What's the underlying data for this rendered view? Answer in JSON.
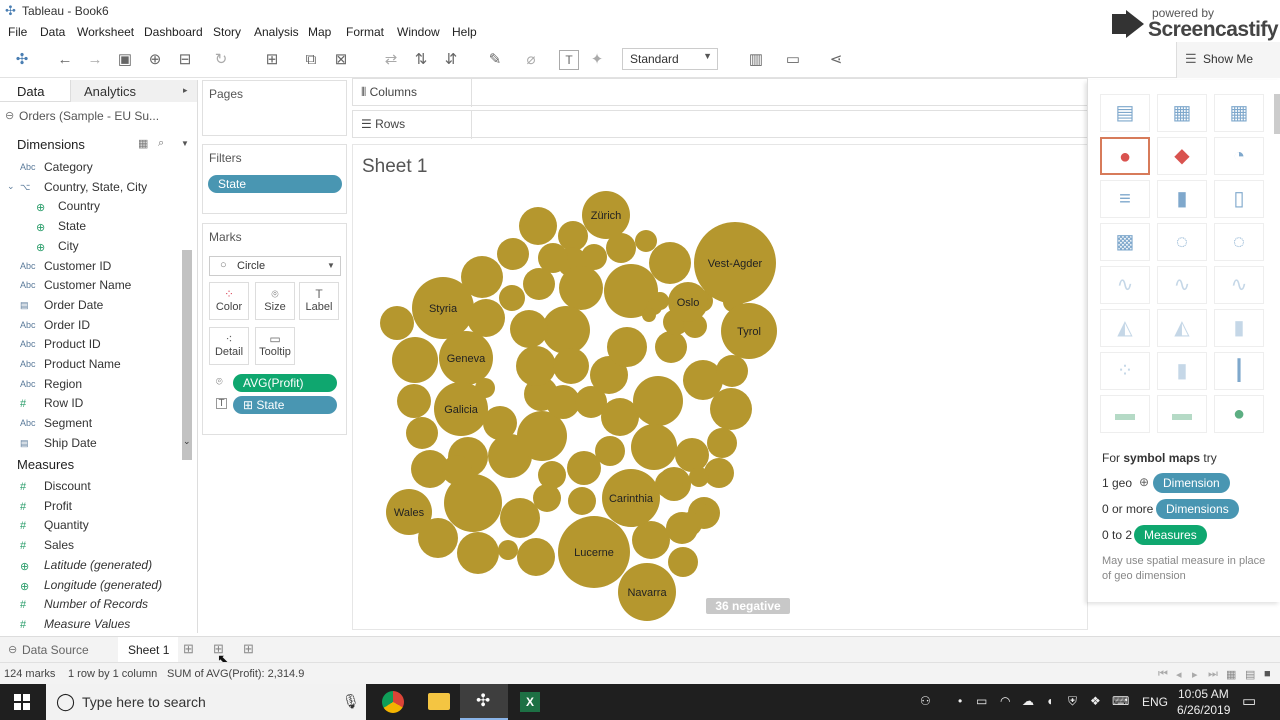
{
  "window": {
    "title": "Tableau - Book6"
  },
  "menu": [
    "File",
    "Data",
    "Worksheet",
    "Dashboard",
    "Story",
    "Analysis",
    "Map",
    "Format",
    "Window",
    "Help"
  ],
  "toolbar": {
    "fit": "Standard",
    "show_me": "Show Me"
  },
  "watermark": {
    "line1": "powered by",
    "line2": "Screencastify"
  },
  "data_pane": {
    "tab_data": "Data",
    "tab_analytics": "Analytics",
    "datasource": "Orders (Sample - EU Su...",
    "dimensions_header": "Dimensions",
    "dimensions": [
      {
        "type": "Abc",
        "label": "Category"
      },
      {
        "type": "hier",
        "label": "Country, State, City"
      },
      {
        "type": "geo",
        "label": "Country"
      },
      {
        "type": "geo",
        "label": "State"
      },
      {
        "type": "geo",
        "label": "City"
      },
      {
        "type": "Abc",
        "label": "Customer ID"
      },
      {
        "type": "Abc",
        "label": "Customer Name"
      },
      {
        "type": "date",
        "label": "Order Date"
      },
      {
        "type": "Abc",
        "label": "Order ID"
      },
      {
        "type": "Abc",
        "label": "Product ID"
      },
      {
        "type": "Abc",
        "label": "Product Name"
      },
      {
        "type": "Abc",
        "label": "Region"
      },
      {
        "type": "#",
        "label": "Row ID"
      },
      {
        "type": "Abc",
        "label": "Segment"
      },
      {
        "type": "date",
        "label": "Ship Date"
      }
    ],
    "measures_header": "Measures",
    "measures": [
      {
        "type": "#",
        "label": "Discount"
      },
      {
        "type": "#",
        "label": "Profit"
      },
      {
        "type": "#",
        "label": "Quantity"
      },
      {
        "type": "#",
        "label": "Sales"
      },
      {
        "type": "geo",
        "label": "Latitude (generated)"
      },
      {
        "type": "geo",
        "label": "Longitude (generated)"
      },
      {
        "type": "#",
        "label": "Number of Records"
      },
      {
        "type": "#",
        "label": "Measure Values"
      }
    ]
  },
  "shelves": {
    "pages": "Pages",
    "filters": "Filters",
    "filter_pill": "State",
    "marks": "Marks",
    "mark_type": "Circle",
    "mark_buttons": [
      "Color",
      "Size",
      "Label",
      "Detail",
      "Tooltip"
    ],
    "mark_pill_1": "AVG(Profit)",
    "mark_pill_2": "State",
    "columns": "Columns",
    "rows": "Rows"
  },
  "viz": {
    "sheet_title": "Sheet 1",
    "negative_badge": "36 negative",
    "labeled_bubbles": [
      "Zürich",
      "Vest-Agder",
      "Styria",
      "Oslo",
      "Tyrol",
      "Geneva",
      "Galicia",
      "Carinthia",
      "Wales",
      "Lucerne",
      "Navarra"
    ],
    "bubble_color": "#b5972e"
  },
  "show_me": {
    "hint_prefix": "For",
    "hint_bold": "symbol maps",
    "hint_suffix": "try",
    "req1_count": "1 geo",
    "req1_pill": "Dimension",
    "req2_count": "0 or more",
    "req2_pill": "Dimensions",
    "req3_count": "0 to 2",
    "req3_pill": "Measures",
    "note": "May use spatial measure in place of geo dimension"
  },
  "bottom_tabs": {
    "data_source": "Data Source",
    "sheet": "Sheet 1"
  },
  "status": {
    "marks": "124 marks",
    "dims": "1 row by 1 column",
    "sum": "SUM of AVG(Profit): 2,314.9"
  },
  "taskbar": {
    "search_placeholder": "Type here to search",
    "lang": "ENG",
    "time": "10:05 AM",
    "date": "6/26/2019"
  }
}
